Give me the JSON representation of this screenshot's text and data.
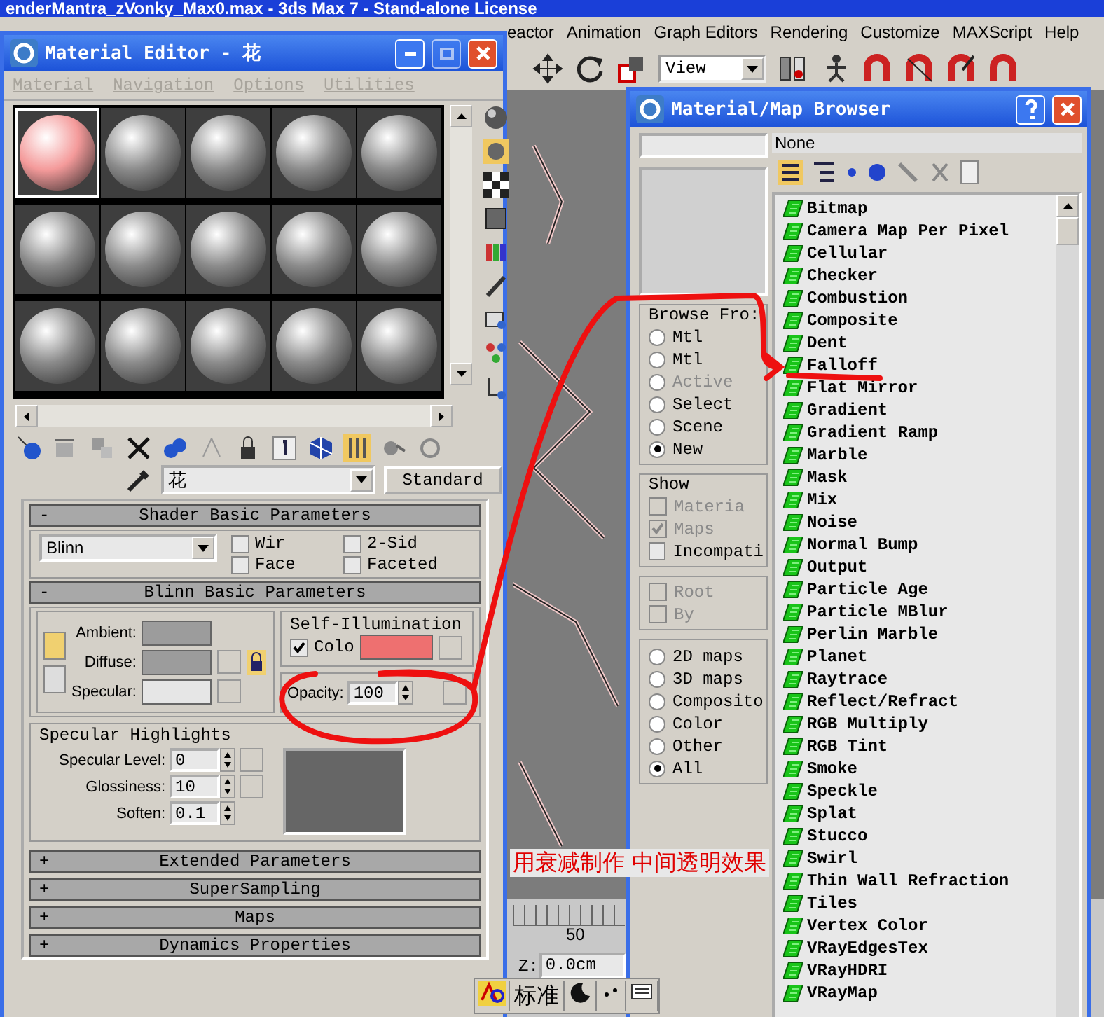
{
  "app_title": "enderMantra_zVonky_Max0.max - 3ds Max 7 - Stand-alone License",
  "menu": [
    "eactor",
    "Animation",
    "Graph Editors",
    "Rendering",
    "Customize",
    "MAXScript",
    "Help"
  ],
  "toolbar": {
    "view_dropdown": "View"
  },
  "viewport": {
    "ruler_label": "50",
    "z_label": "Z:",
    "z_value": "0.0cm"
  },
  "ime_bar": {
    "label": "标准"
  },
  "material_editor": {
    "title": "Material Editor - 花",
    "menu": [
      "Material",
      "Navigation",
      "Options",
      "Utilities"
    ],
    "slots": [
      {
        "selected": true,
        "color": "#f49a9a"
      },
      {
        "selected": false,
        "color": "#8a8a8a"
      },
      {
        "selected": false,
        "color": "#8a8a8a"
      },
      {
        "selected": false,
        "color": "#8a8a8a"
      },
      {
        "selected": false,
        "color": "#8a8a8a"
      },
      {
        "selected": false,
        "color": "#8a8a8a"
      },
      {
        "selected": false,
        "color": "#8a8a8a"
      },
      {
        "selected": false,
        "color": "#8a8a8a"
      },
      {
        "selected": false,
        "color": "#8a8a8a"
      },
      {
        "selected": false,
        "color": "#8a8a8a"
      },
      {
        "selected": false,
        "color": "#8a8a8a"
      },
      {
        "selected": false,
        "color": "#8a8a8a"
      },
      {
        "selected": false,
        "color": "#8a8a8a"
      },
      {
        "selected": false,
        "color": "#8a8a8a"
      },
      {
        "selected": false,
        "color": "#8a8a8a"
      }
    ],
    "material_name": "花",
    "material_type": "Standard",
    "shader_section": {
      "sign": "-",
      "title": "Shader Basic Parameters",
      "shader": "Blinn",
      "options": [
        {
          "label": "Wir",
          "checked": false
        },
        {
          "label": "2-Sid",
          "checked": false
        },
        {
          "label": "Face",
          "checked": false
        },
        {
          "label": "Faceted",
          "checked": false
        }
      ]
    },
    "blinn_section": {
      "sign": "-",
      "title": "Blinn Basic Parameters",
      "colors": [
        {
          "label": "Ambient:",
          "color": "#9c9c9c"
        },
        {
          "label": "Diffuse:",
          "color": "#9c9c9c"
        },
        {
          "label": "Specular:",
          "color": "#e6e6e6"
        }
      ],
      "self_illumination": {
        "title": "Self-Illumination",
        "checked": true,
        "label": "Colo",
        "color": "#ee7070"
      },
      "opacity": {
        "label": "Opacity:",
        "value": "100"
      }
    },
    "specular_highlights": {
      "title": "Specular Highlights",
      "fields": [
        {
          "label": "Specular Level:",
          "value": "0"
        },
        {
          "label": "Glossiness:",
          "value": "10"
        },
        {
          "label": "Soften:",
          "value": "0.1"
        }
      ]
    },
    "rollouts": [
      {
        "sign": "+",
        "title": "Extended Parameters"
      },
      {
        "sign": "+",
        "title": "SuperSampling"
      },
      {
        "sign": "+",
        "title": "Maps"
      },
      {
        "sign": "+",
        "title": "Dynamics Properties"
      }
    ]
  },
  "browser": {
    "title": "Material/Map Browser",
    "none_label": "None",
    "browse_from": {
      "title": "Browse Fro:",
      "items": [
        {
          "label": "Mtl",
          "selected": false,
          "disabled": false
        },
        {
          "label": "Mtl",
          "selected": false,
          "disabled": false
        },
        {
          "label": "Active",
          "selected": false,
          "disabled": true
        },
        {
          "label": "Select",
          "selected": false,
          "disabled": false
        },
        {
          "label": "Scene",
          "selected": false,
          "disabled": false
        },
        {
          "label": "New",
          "selected": true,
          "disabled": false
        }
      ]
    },
    "show": {
      "title": "Show",
      "items": [
        {
          "label": "Materia",
          "checked": false,
          "disabled": true
        },
        {
          "label": "Maps",
          "checked": true,
          "disabled": true
        },
        {
          "label": "Incompati",
          "checked": false,
          "disabled": false
        }
      ]
    },
    "root_options": [
      {
        "label": "Root",
        "checked": false,
        "disabled": true
      },
      {
        "label": "By",
        "checked": false,
        "disabled": true
      }
    ],
    "filters": [
      {
        "label": "2D maps",
        "selected": false
      },
      {
        "label": "3D maps",
        "selected": false
      },
      {
        "label": "Composito",
        "selected": false
      },
      {
        "label": "Color",
        "selected": false
      },
      {
        "label": "Other",
        "selected": false
      },
      {
        "label": "All",
        "selected": true
      }
    ],
    "maps": [
      "Bitmap",
      "Camera Map Per Pixel",
      "Cellular",
      "Checker",
      "Combustion",
      "Composite",
      "Dent",
      "Falloff",
      "Flat Mirror",
      "Gradient",
      "Gradient Ramp",
      "Marble",
      "Mask",
      "Mix",
      "Noise",
      "Normal Bump",
      "Output",
      "Particle Age",
      "Particle MBlur",
      "Perlin Marble",
      "Planet",
      "Raytrace",
      "Reflect/Refract",
      "RGB Multiply",
      "RGB Tint",
      "Smoke",
      "Speckle",
      "Splat",
      "Stucco",
      "Swirl",
      "Thin Wall Refraction",
      "Tiles",
      "Vertex Color",
      "VRayEdgesTex",
      "VRayHDRI",
      "VRayMap"
    ]
  },
  "annotation": {
    "text": "用衰减制作 中间透明效果"
  }
}
